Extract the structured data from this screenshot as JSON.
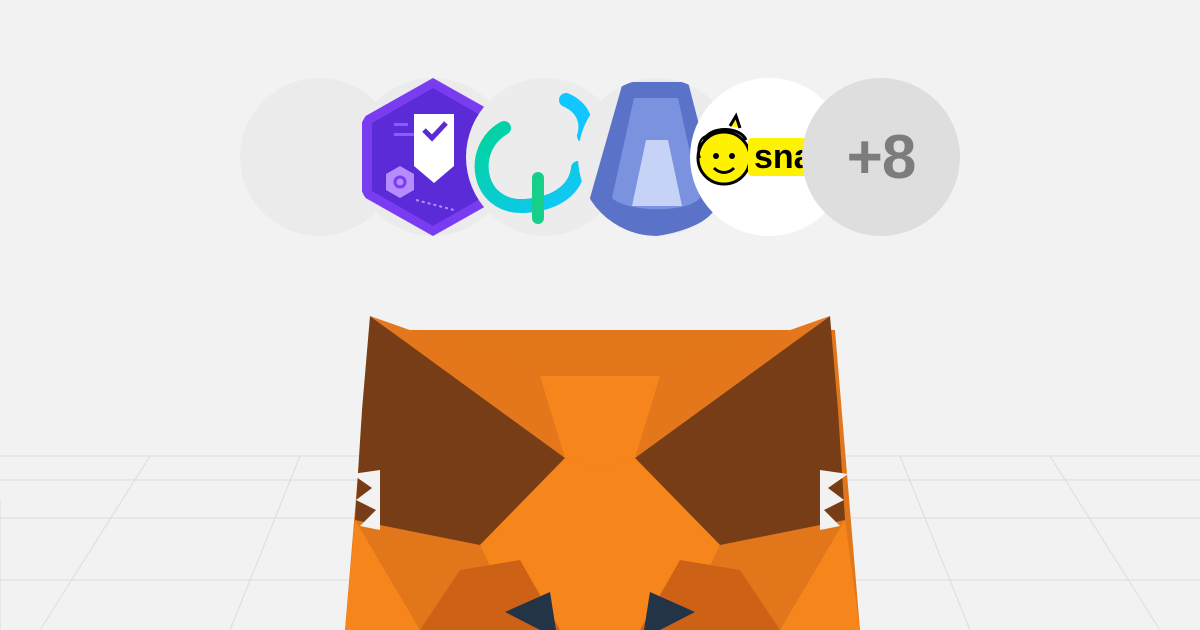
{
  "integrations": {
    "logos": [
      {
        "name": "blank-integration-logo",
        "icon": "empty-circle"
      },
      {
        "name": "purple-shield-logo",
        "icon": "shield-check-icon"
      },
      {
        "name": "teal-link-logo",
        "icon": "teal-hook-icon"
      },
      {
        "name": "blue-a-logo",
        "icon": "blue-a-icon"
      },
      {
        "name": "snap-logo",
        "icon": "snap-mascot-icon",
        "label": "sna"
      }
    ],
    "more_label": "+8"
  },
  "colors": {
    "background": "#f2f2f2",
    "more_bubble": "#dedede",
    "more_text": "#7c7c7c",
    "fox_orange": "#f6851b",
    "fox_dark_orange": "#e2761b",
    "fox_ear": "#763d16",
    "snap_yellow": "#fff200",
    "shield_purple": "#5b2bd8",
    "teal": "#00d1a0",
    "a_blue": "#5a72c8"
  },
  "mascot": {
    "icon": "metamask-fox-icon"
  }
}
